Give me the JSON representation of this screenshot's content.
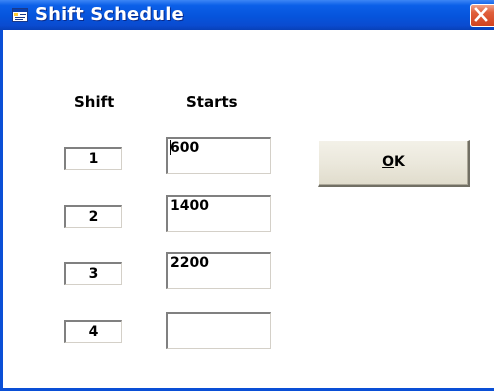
{
  "window": {
    "title": "Shift Schedule",
    "close_glyph": "✕"
  },
  "headers": {
    "shift": "Shift",
    "starts": "Starts"
  },
  "rows": [
    {
      "shift": "1",
      "start": "600"
    },
    {
      "shift": "2",
      "start": "1400"
    },
    {
      "shift": "3",
      "start": "2200"
    },
    {
      "shift": "4",
      "start": ""
    }
  ],
  "ok_button": {
    "mnemonic": "O",
    "rest": "K"
  },
  "colors": {
    "titlebar": "#0654dc",
    "close": "#d2421f",
    "button_face": "#ebe8dc"
  },
  "icons": {
    "title": "app-window-icon",
    "close": "close-icon"
  }
}
